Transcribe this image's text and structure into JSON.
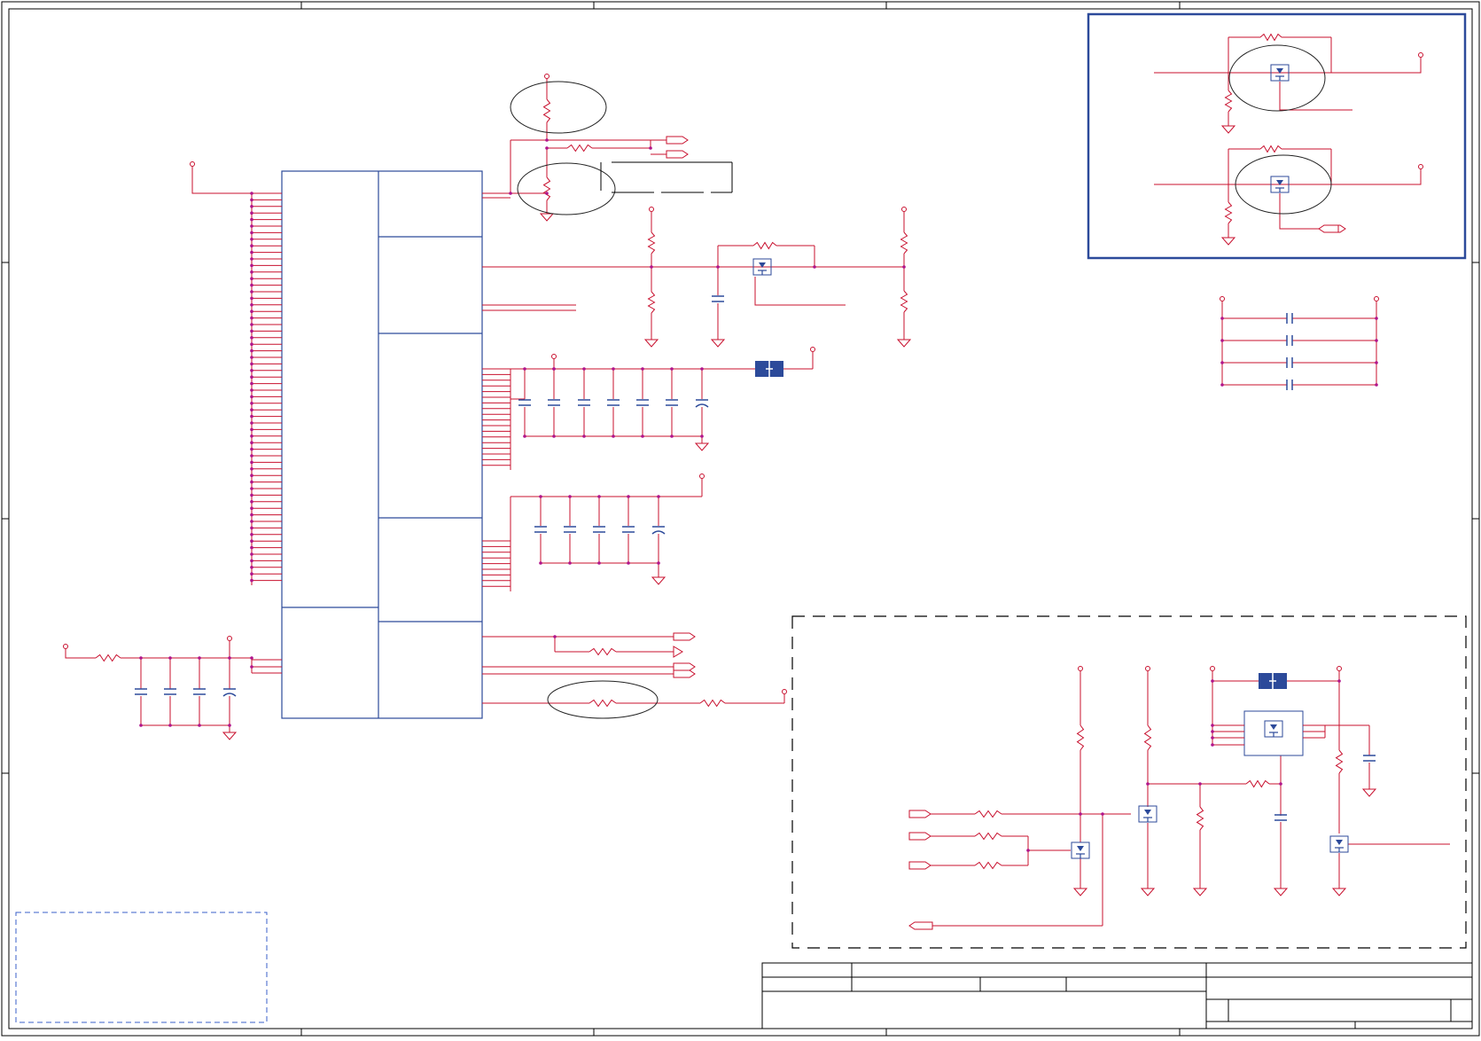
{
  "document": {
    "kind": "circuit schematic sheet",
    "text_labels": [],
    "title_block": {}
  },
  "colors": {
    "wire": "#c8102e",
    "component": "#2c4a9a",
    "junction": "#b0148c",
    "frame": "#000000",
    "highlight_ellipse": "#222222",
    "dashed_region": "#000000",
    "note_box": "#3a5fc8"
  },
  "symbols": [
    "power-port",
    "ground-symbol",
    "resistor",
    "capacitor",
    "polarized-capacitor",
    "mosfet",
    "net-port",
    "fuse-block",
    "ic-block"
  ]
}
